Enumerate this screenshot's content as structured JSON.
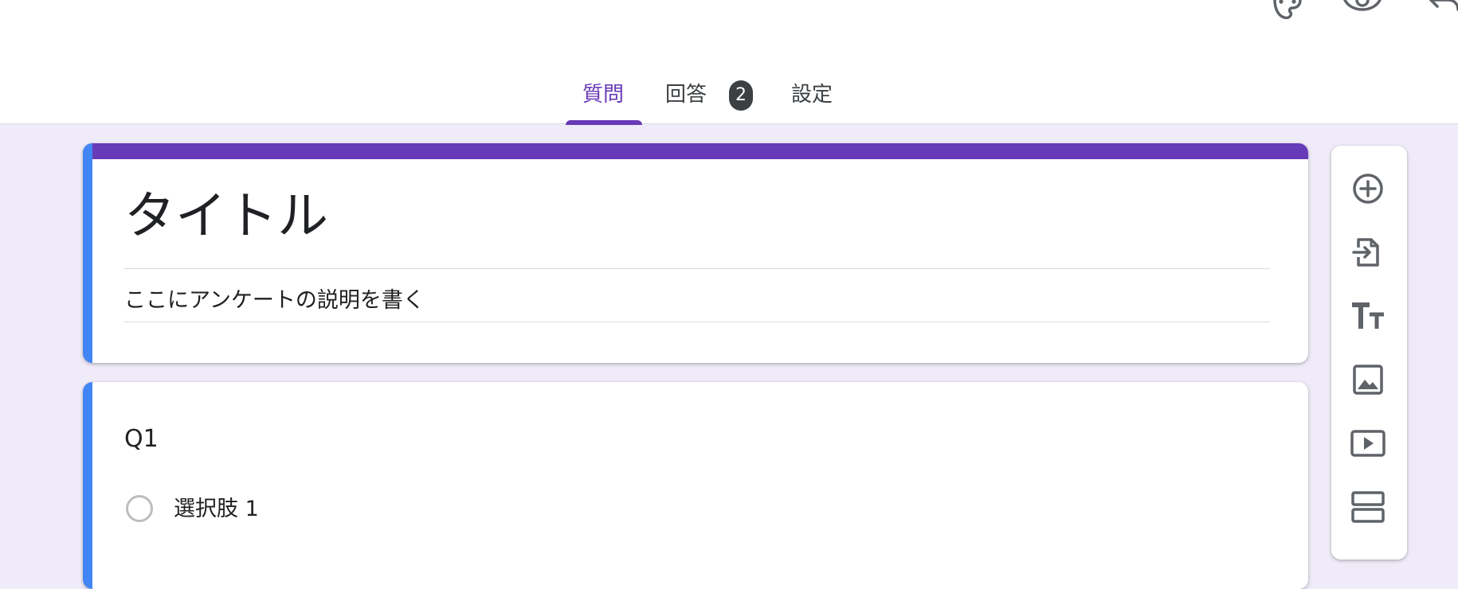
{
  "colors": {
    "accent": "#673ab7",
    "card_left_accent": "#4285f4",
    "background": "#f0ebf8",
    "icon": "#5f6368",
    "badge": "#3c4043"
  },
  "top_icons": [
    "palette-icon",
    "eye-icon",
    "undo-icon"
  ],
  "tabs": [
    {
      "label": "質問",
      "active": true
    },
    {
      "label": "回答",
      "badge": "2",
      "active": false
    },
    {
      "label": "設定",
      "active": false
    }
  ],
  "form": {
    "title": "タイトル",
    "description": "ここにアンケートの説明を書く"
  },
  "question": {
    "title": "Q1",
    "options": [
      "選択肢 1"
    ]
  },
  "toolbar": {
    "icons": [
      "add-question-icon",
      "import-questions-icon",
      "add-title-icon",
      "add-image-icon",
      "add-video-icon",
      "add-section-icon"
    ]
  }
}
